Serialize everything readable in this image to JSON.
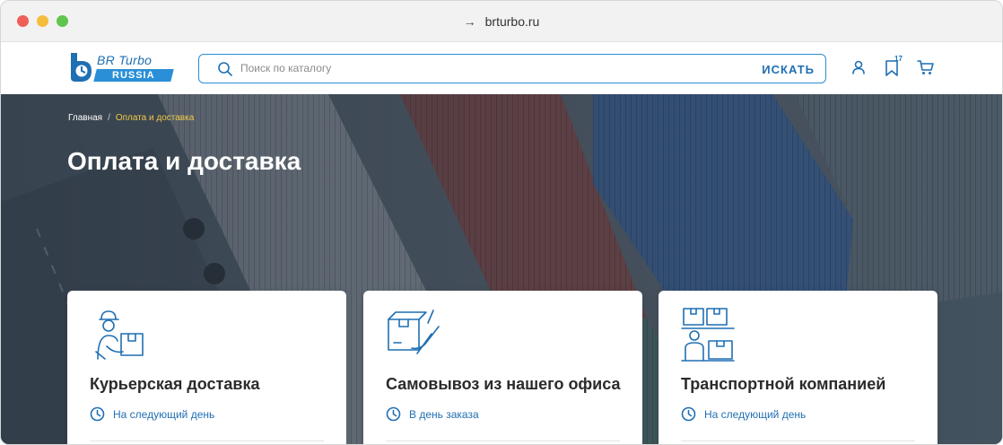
{
  "browser": {
    "url": "brturbo.ru",
    "nav_arrow": "→"
  },
  "header": {
    "logo": {
      "top": "BR Turbo",
      "bottom": "RUSSIA"
    },
    "search": {
      "placeholder": "Поиск по каталогу",
      "value": "",
      "button_label": "ИСКАТЬ"
    },
    "favorites_count": "17",
    "icons": [
      "user-icon",
      "bookmark-icon",
      "cart-icon"
    ]
  },
  "breadcrumb": {
    "home": "Главная",
    "separator": "/",
    "current": "Оплата и доставка"
  },
  "page": {
    "title": "Оплата и доставка"
  },
  "cards": [
    {
      "title": "Курьерская доставка",
      "timing": "На следующий день",
      "icon": "courier-icon"
    },
    {
      "title": "Самовывоз из нашего офиса",
      "timing": "В день заказа",
      "icon": "pickup-box-icon"
    },
    {
      "title": "Транспортной компанией",
      "timing": "На следующий день",
      "icon": "warehouse-icon"
    }
  ],
  "colors": {
    "accent": "#1f6fb3",
    "breadcrumb_current": "#f3c947",
    "hero_overlay": "#3b4a59"
  }
}
